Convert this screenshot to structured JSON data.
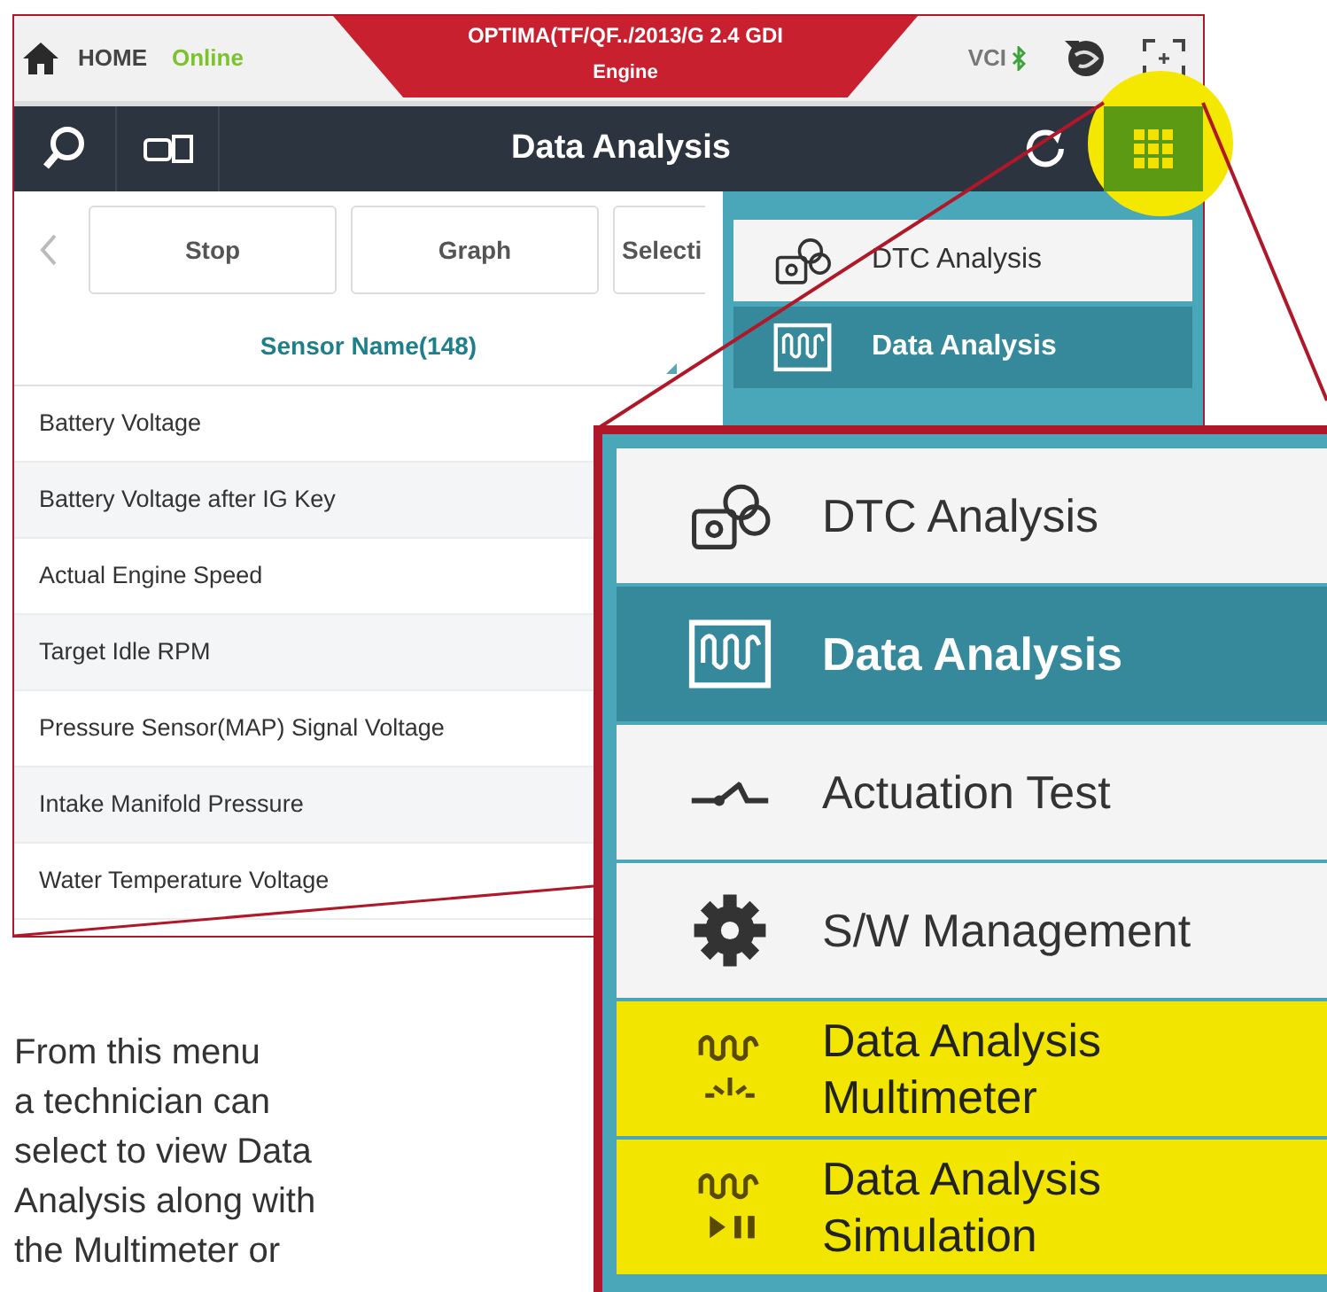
{
  "header": {
    "home_label": "HOME",
    "status": "Online",
    "vehicle": "OPTIMA(TF/QF../2013/G 2.4 GDI",
    "system": "Engine",
    "vci_label": "VCI"
  },
  "toolbar": {
    "title": "Data Analysis"
  },
  "buttons": [
    "Stop",
    "Graph",
    "Selecti"
  ],
  "column_header": "Sensor Name(148)",
  "sensors": [
    "Battery Voltage",
    "Battery Voltage after IG Key",
    "Actual Engine Speed",
    "Target Idle RPM",
    "Pressure Sensor(MAP) Signal Voltage",
    "Intake Manifold Pressure",
    "Water Temperature Voltage"
  ],
  "menu": [
    {
      "label": "DTC Analysis",
      "kind": "dtc",
      "selected": false
    },
    {
      "label": "Data Analysis",
      "kind": "data",
      "selected": true
    }
  ],
  "callout_menu": [
    {
      "label": "DTC Analysis",
      "kind": "dtc",
      "selected": false,
      "highlighted": false
    },
    {
      "label": "Data Analysis",
      "kind": "data",
      "selected": true,
      "highlighted": false
    },
    {
      "label": "Actuation Test",
      "kind": "switch",
      "selected": false,
      "highlighted": false
    },
    {
      "label": "S/W Management",
      "kind": "gear",
      "selected": false,
      "highlighted": false
    },
    {
      "label": "Data Analysis Multimeter",
      "kind": "multimeter",
      "selected": false,
      "highlighted": true
    },
    {
      "label": "Data Analysis Simulation",
      "kind": "simulation",
      "selected": false,
      "highlighted": true
    }
  ],
  "caption": [
    "From this menu",
    "a technician can",
    "select to view Data",
    "Analysis along with",
    "the Multimeter or"
  ]
}
